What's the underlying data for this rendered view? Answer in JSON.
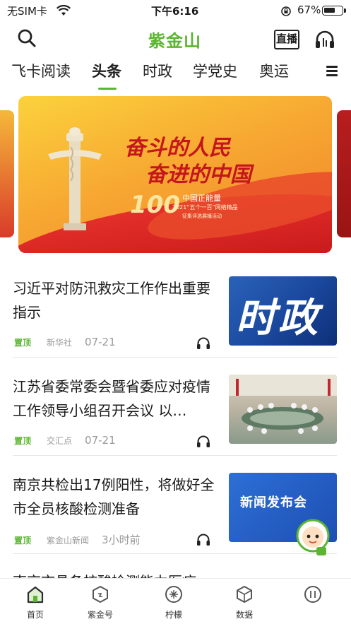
{
  "status_bar": {
    "carrier": "无SIM卡",
    "time": "下午6:16",
    "battery": "67%",
    "battery_level": 0.67
  },
  "header": {
    "logo": "紫金山",
    "live_label": "直播",
    "icons": [
      "search-icon",
      "headphone-icon"
    ]
  },
  "tabs": [
    {
      "label": "飞卡阅读",
      "active": false
    },
    {
      "label": "头条",
      "active": true
    },
    {
      "label": "时政",
      "active": false
    },
    {
      "label": "学党史",
      "active": false
    },
    {
      "label": "奥运",
      "active": false
    }
  ],
  "banner": {
    "headline_1": "奋斗的人民",
    "headline_2": "奋进的中国",
    "badge_number": "100",
    "subtitle_1": "中国正能量",
    "subtitle_2": "2021“五个一百”网络精品",
    "subtitle_3": "征集评选展播活动"
  },
  "news": [
    {
      "title": "习近平对防汛救灾工作作出重要指示",
      "tag": "置顶",
      "source": "新华社",
      "date": "07-21",
      "thumb_text": "时政"
    },
    {
      "title": "江苏省委常委会暨省委应对疫情工作领导小组召开会议 以…",
      "tag": "置顶",
      "source": "交汇点",
      "date": "07-21",
      "thumb_text": ""
    },
    {
      "title": "南京共检出17例阳性，将做好全市全员核酸检测准备",
      "tag": "置顶",
      "source": "紫金山新闻",
      "date": "3小时前",
      "thumb_text": "新闻发布会"
    }
  ],
  "partial_next_title": "南京市具备核酸检测能力医疗",
  "bottom_nav": [
    {
      "label": "首页",
      "icon": "home-icon",
      "active": true
    },
    {
      "label": "紫金号",
      "icon": "hexagon-icon",
      "active": false
    },
    {
      "label": "柠檬",
      "icon": "lemon-icon",
      "active": false
    },
    {
      "label": "数据",
      "icon": "data-cube-icon",
      "active": false
    },
    {
      "label": "",
      "icon": "profile-icon",
      "active": false
    }
  ],
  "colors": {
    "accent": "#5cb531",
    "banner_red": "#c4161c",
    "thumb_blue": "#1b4aa0"
  }
}
